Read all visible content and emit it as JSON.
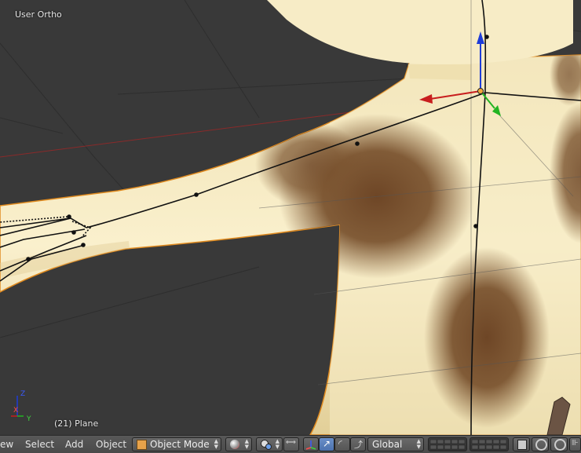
{
  "viewport": {
    "view_name": "User Ortho",
    "object_info": "(21) Plane",
    "axis_labels": {
      "x": "X",
      "y": "Y",
      "z": "Z"
    }
  },
  "header": {
    "menus": [
      "ew",
      "Select",
      "Add",
      "Object"
    ],
    "mode_label": "Object Mode",
    "orientation_label": "Global"
  },
  "colors": {
    "viewport_bg": "#393939",
    "skin": "#f3e7bd",
    "spot": "#7b5430",
    "selection_outline": "#e08a1e",
    "axis_x": "#c81e1e",
    "axis_y": "#22b422",
    "axis_z": "#1e3cd8",
    "header_bg": "#4f4f4f"
  },
  "icons": {
    "mode_icon": "cube-icon",
    "shading_icon": "sphere-shading-icon",
    "pivot_icon": "pivot-point-icon",
    "manipulator_icons": [
      "translate-icon",
      "rotate-icon",
      "scale-icon"
    ],
    "snap_icons": [
      "ring-icon",
      "snap-icon"
    ]
  }
}
